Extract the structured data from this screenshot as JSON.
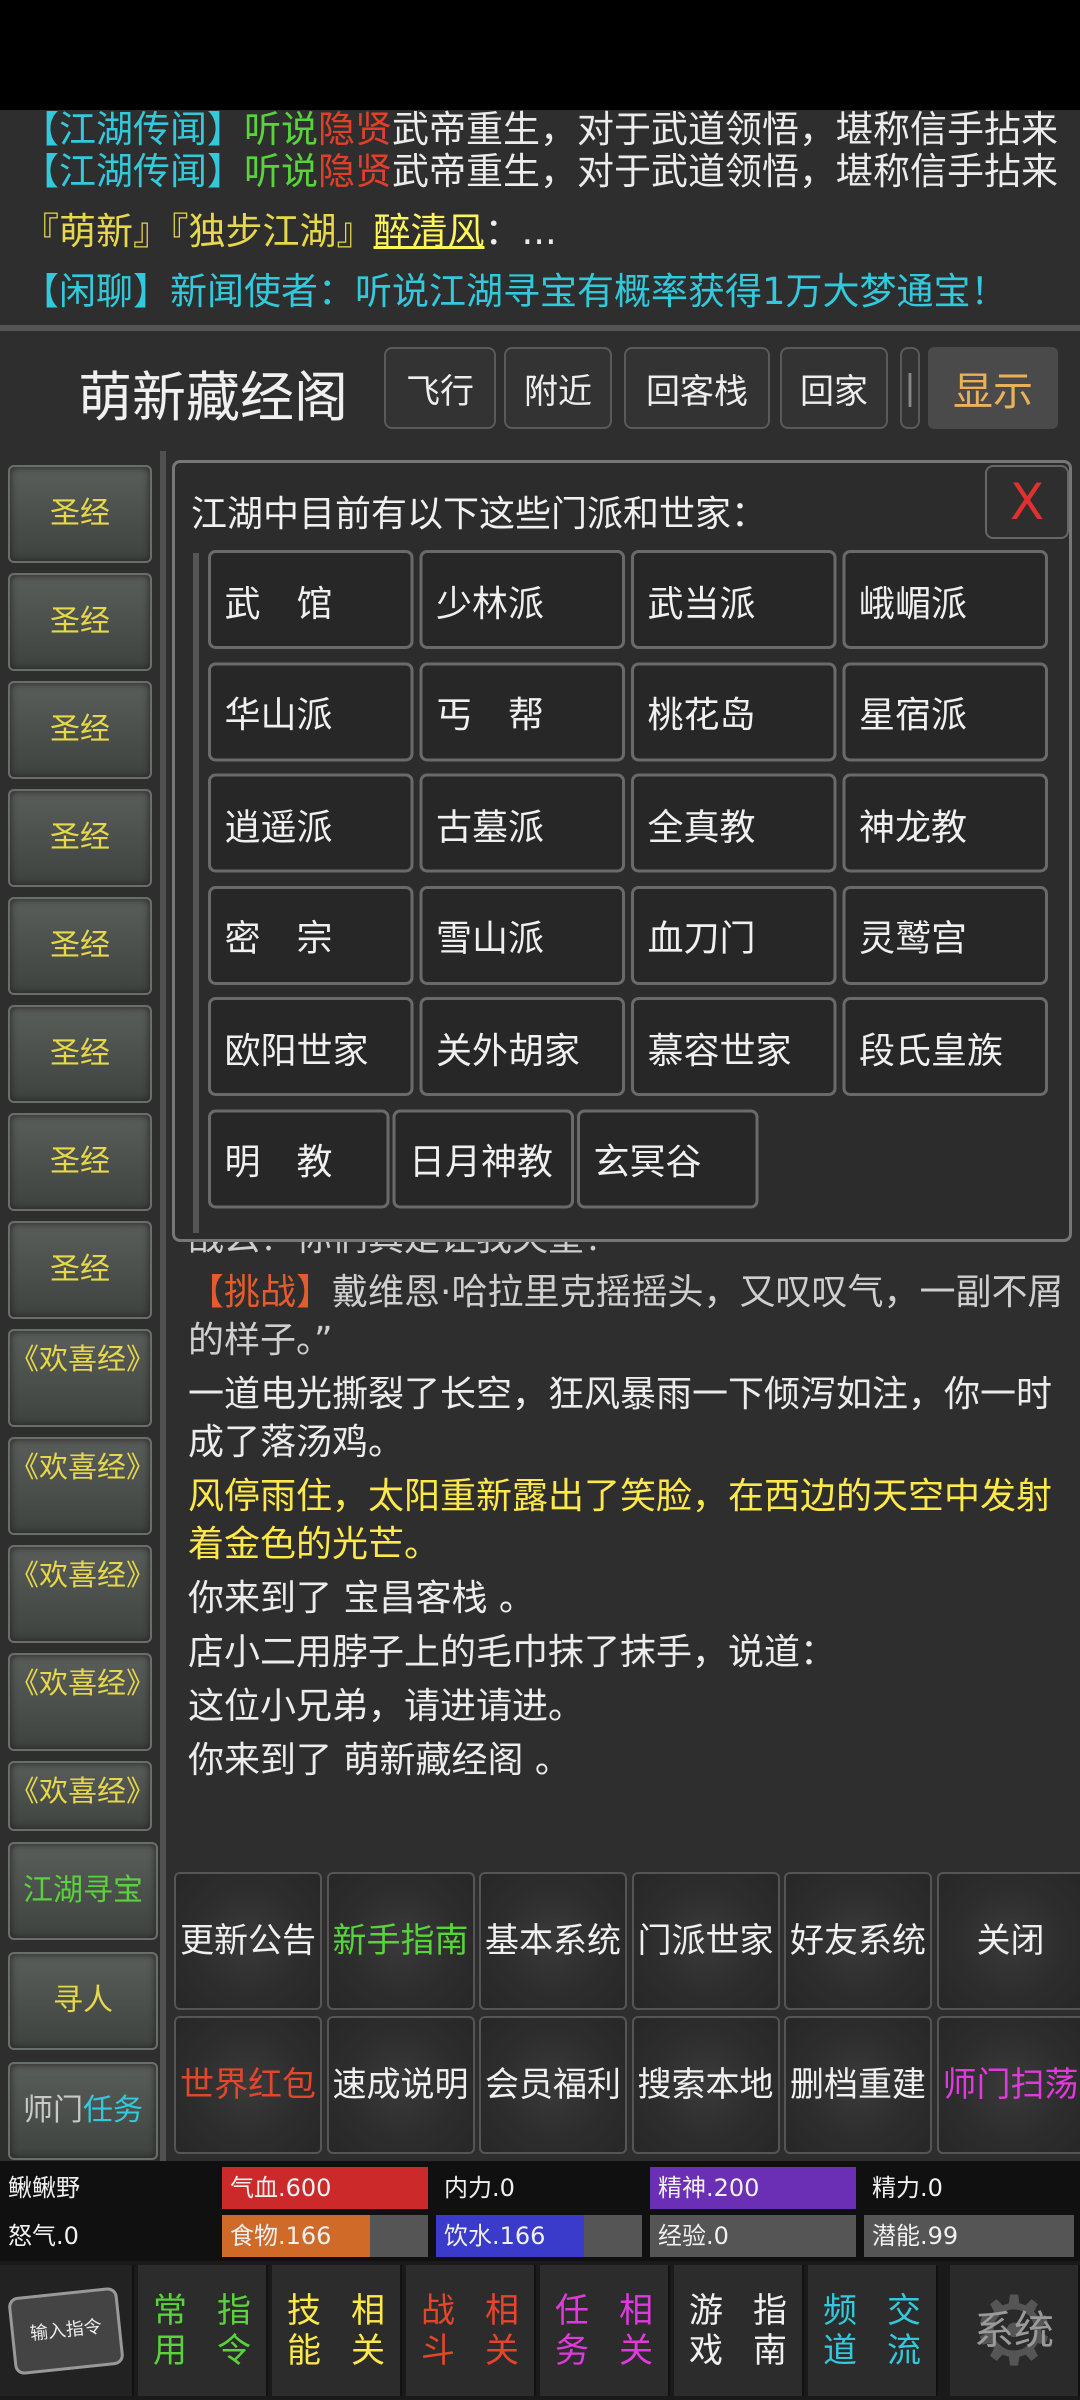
{
  "news": {
    "line0": {
      "tag": "【江湖传闻】",
      "a": "听说",
      "b": "隐贤",
      "c": "武帝重生，对于武道领悟，堪称信手拈来"
    },
    "line1": {
      "tag": "【江湖传闻】",
      "a": "听说",
      "b": "隐贤",
      "c": "武帝重生，对于武道领悟，堪称信手拈来"
    },
    "line2": {
      "a": "『萌新』『独步江湖』",
      "name": "醉清风",
      "c": "：..."
    },
    "line3": {
      "tag": "【闲聊】",
      "c": "新闻使者：听说江湖寻宝有概率获得1万大梦通宝！"
    }
  },
  "header": {
    "title": "萌新藏经阁",
    "buttons": [
      "飞行",
      "附近",
      "回客栈",
      "回家",
      "|"
    ],
    "show": "显示"
  },
  "sidebar": {
    "items": [
      "圣经",
      "圣经",
      "圣经",
      "圣经",
      "圣经",
      "圣经",
      "圣经",
      "圣经",
      "《欢喜经》",
      "《欢喜经》",
      "《欢喜经》",
      "《欢喜经》",
      "《欢喜经》"
    ],
    "actions": [
      "江湖寻宝",
      "寻人"
    ],
    "quest": {
      "a": "师门",
      "b": "任务"
    }
  },
  "dialog": {
    "title": "江湖中目前有以下这些门派和世家：",
    "close": "X",
    "sects": [
      "武　馆",
      "少林派",
      "武当派",
      "峨嵋派",
      "华山派",
      "丐　帮",
      "桃花岛",
      "星宿派",
      "逍遥派",
      "古墓派",
      "全真教",
      "神龙教",
      "密　宗",
      "雪山派",
      "血刀门",
      "灵鹫宫",
      "欧阳世家",
      "关外胡家",
      "慕容世家",
      "段氏皇族",
      "明　教",
      "日月神教",
      "玄冥谷"
    ]
  },
  "log": {
    "p0": "【挑战】戴维恩·哈拉里克：“怎么，连神度大战都不应战么？你们真是让我失望！”",
    "p0_visible": "战么？你们真是让我失望！”",
    "p1_tag": "【挑战】",
    "p1": "戴维恩·哈拉里克摇摇头，又叹叹气，一副不屑的样子。”",
    "p2": "一道电光撕裂了长空，狂风暴雨一下倾泻如注，你一时成了落汤鸡。",
    "p3": "风停雨住，太阳重新露出了笑脸，在西边的天空中发射着金色的光芒。",
    "p4": "你来到了 宝昌客栈 。",
    "p5": "店小二用脖子上的毛巾抹了抹手，说道：",
    "p6": "这位小兄弟，请进请进。",
    "p7": "你来到了 萌新藏经阁 。"
  },
  "commands": [
    {
      "l1": "更新",
      "l2": "公告",
      "color": "white"
    },
    {
      "l1": "新手",
      "l2": "指南",
      "color": "green"
    },
    {
      "l1": "基本",
      "l2": "系统",
      "color": "white"
    },
    {
      "l1": "门派",
      "l2": "世家",
      "color": "white"
    },
    {
      "l1": "好友",
      "l2": "系统",
      "color": "white"
    },
    {
      "l1": "关",
      "l2": "闭",
      "color": "white"
    },
    {
      "l1": "世界",
      "l2": "红包",
      "color": "red"
    },
    {
      "l1": "速成",
      "l2": "说明",
      "color": "white"
    },
    {
      "l1": "会员",
      "l2": "福利",
      "color": "white"
    },
    {
      "l1": "搜索",
      "l2": "本地",
      "color": "white"
    },
    {
      "l1": "删档",
      "l2": "重建",
      "color": "white"
    },
    {
      "l1": "师门",
      "l2": "扫荡",
      "color": "magenta"
    }
  ],
  "stats": {
    "name": "鳅鳅野",
    "hp": "气血.600",
    "hp_pct": 100,
    "neili": "内力.0",
    "neili_pct": 0,
    "jingshen": "精神.200",
    "jingshen_pct": 100,
    "jingli": "精力.0",
    "jingli_pct": 0,
    "nuqi": "怒气.0",
    "food": "食物.166",
    "food_pct": 72,
    "water": "饮水.166",
    "water_pct": 72,
    "exp": "经验.0",
    "exp_pct": 0,
    "potential": "潜能.99",
    "potential_pct": 0
  },
  "nav": {
    "input": "输入指令",
    "items": [
      {
        "l1": "常用",
        "l2": "指令",
        "color": "#59d33a"
      },
      {
        "l1": "技能",
        "l2": "相关",
        "color": "#ffe94a"
      },
      {
        "l1": "战斗",
        "l2": "相关",
        "color": "#e4462c"
      },
      {
        "l1": "任务",
        "l2": "相关",
        "color": "#e03adf"
      },
      {
        "l1": "游戏",
        "l2": "指南",
        "color": "#f0f0f0"
      },
      {
        "l1": "频道",
        "l2": "交流",
        "color": "#33c9dc"
      }
    ],
    "system": "系统"
  },
  "colors": {
    "hp": "#cc2a2a",
    "jingshen": "#6a2fb5",
    "food": "#d06a28",
    "water": "#3a3acb",
    "bar_bg": "#555555"
  }
}
